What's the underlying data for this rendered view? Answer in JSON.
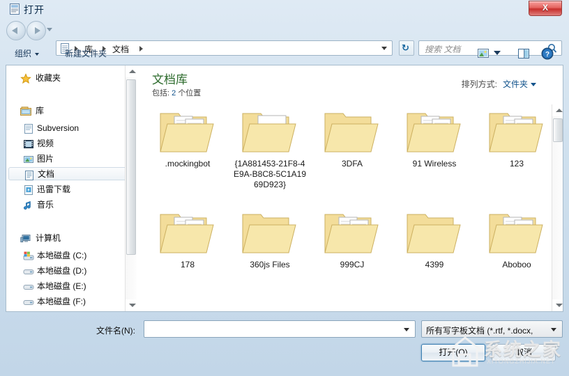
{
  "window": {
    "title": "打开",
    "title_icon": "document-window-icon",
    "close_label": "X"
  },
  "navbar": {
    "back_tooltip": "后退",
    "forward_tooltip": "前进",
    "breadcrumb": [
      "库",
      "文档"
    ],
    "refresh_glyph": "↻",
    "search": {
      "placeholder": "搜索 文档",
      "icon": "search-icon"
    }
  },
  "toolbar": {
    "organize_label": "组织",
    "new_folder_label": "新建文件夹",
    "view_icon": "view-mode-icon",
    "preview_icon": "preview-pane-icon",
    "help_icon": "help-icon",
    "help_glyph": "?"
  },
  "sidebar": {
    "sections": [
      {
        "label": "收藏夹",
        "icon": "star-icon",
        "items": []
      },
      {
        "label": "库",
        "icon": "library-icon",
        "items": [
          {
            "label": "Subversion",
            "icon": "subversion-icon",
            "selected": false
          },
          {
            "label": "视频",
            "icon": "video-icon",
            "selected": false
          },
          {
            "label": "图片",
            "icon": "pictures-icon",
            "selected": false
          },
          {
            "label": "文档",
            "icon": "documents-icon",
            "selected": true
          },
          {
            "label": "迅雷下载",
            "icon": "thunder-download-icon",
            "selected": false
          },
          {
            "label": "音乐",
            "icon": "music-icon",
            "selected": false
          }
        ]
      },
      {
        "label": "计算机",
        "icon": "computer-icon",
        "items": [
          {
            "label": "本地磁盘 (C:)",
            "icon": "system-drive-icon",
            "selected": false
          },
          {
            "label": "本地磁盘 (D:)",
            "icon": "drive-icon",
            "selected": false
          },
          {
            "label": "本地磁盘 (E:)",
            "icon": "drive-icon",
            "selected": false
          },
          {
            "label": "本地磁盘 (F:)",
            "icon": "drive-icon",
            "selected": false
          }
        ]
      }
    ]
  },
  "library_header": {
    "title": "文档库",
    "subtitle_prefix": "包括:",
    "subtitle_count": "2",
    "subtitle_suffix": "个位置",
    "arrange_label": "排列方式:",
    "arrange_value": "文件夹"
  },
  "files": [
    {
      "name": ".mockingbot",
      "type": "folder-with-docs"
    },
    {
      "name": "{1A881453-21F8-4E9A-B8C8-5C1A1969D923}",
      "type": "folder-with-app"
    },
    {
      "name": "3DFA",
      "type": "folder-empty"
    },
    {
      "name": "91 Wireless",
      "type": "folder-with-docs"
    },
    {
      "name": "123",
      "type": "folder-with-docs"
    },
    {
      "name": "178",
      "type": "folder-with-docs"
    },
    {
      "name": "360js Files",
      "type": "folder-empty"
    },
    {
      "name": "999CJ",
      "type": "folder-with-docs"
    },
    {
      "name": "4399",
      "type": "folder-empty"
    },
    {
      "name": "Aboboo",
      "type": "folder-with-docs"
    }
  ],
  "bottom": {
    "filename_label": "文件名(N):",
    "filename_value": "",
    "filetype_value": "所有写字板文档 (*.rtf, *.docx,",
    "open_label": "打开(O)",
    "cancel_label": "取消"
  },
  "watermark": {
    "text": "系统之家",
    "subtext": "XITONGZHIJIA.NET"
  },
  "colors": {
    "library_title": "#2d6b2d",
    "link": "#12538c",
    "folder": "#f5e3a8",
    "close_button": "#c72f2c"
  }
}
